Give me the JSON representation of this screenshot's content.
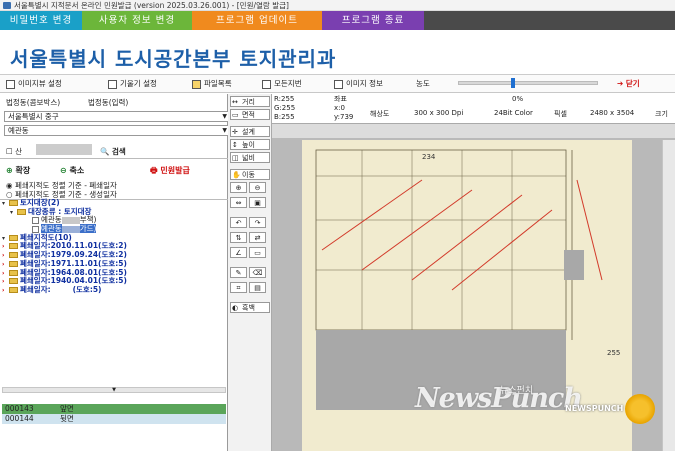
{
  "window": {
    "title": "서울특별시 지적문서 온라인 민원발급 (version 2025.03.26.001) - [민원/열람 발급]"
  },
  "top_menu": [
    {
      "label": "비밀번호 변경",
      "color": "#1aa0c8"
    },
    {
      "label": "사용자 정보 변경",
      "color": "#6cb63a"
    },
    {
      "label": "프로그램 업데이트",
      "color": "#f08a1e"
    },
    {
      "label": "프로그램 종료",
      "color": "#7a3fb0"
    }
  ],
  "banner": {
    "org": "서울특별시 도시공간본부 토지관리과"
  },
  "toolbar": {
    "image_view": "이미지뷰 설정",
    "tilt": "기울기 설정",
    "file_list": "파일목록",
    "all_lots": "모든지번",
    "image_info": "이미지 정보",
    "density": "농도",
    "density_percent": "0%",
    "close": "닫기"
  },
  "left": {
    "tab_sido": "법정동(콤보박스)",
    "tab_input": "법정동(입력)",
    "district": "서울특별시 중구",
    "dong": "예관동",
    "mountain": "산",
    "search": "검색",
    "zoom_in": "확장",
    "zoom_out": "축소",
    "issue": "민원발급",
    "radio1": "폐쇄지적도 정렬 기준 - 폐쇄일자",
    "radio2": "폐쇄지적도 정렬 기준 - 생성일자",
    "tree_root": "토지대장(2)",
    "tree_ledger_type": "대장종류 : 토지대장",
    "tree_item1": "예관동",
    "tree_item1_note": "부책)",
    "tree_item2": "예관동",
    "tree_item2_note": "가드)",
    "closed_root": "폐쇄지적도(10)",
    "closed": [
      "폐쇄일자:2010.11.01(도호:2)",
      "폐쇄일자:1979.09.24(도호:2)",
      "폐쇄일자:1971.11.01(도호:5)",
      "폐쇄일자:1964.08.01(도호:5)",
      "폐쇄일자:1940.04.01(도호:5)",
      "폐쇄일자:",
      "(도호:5)"
    ],
    "pages": [
      {
        "code": "000143",
        "side": "앞면"
      },
      {
        "code": "000144",
        "side": "뒷면"
      }
    ]
  },
  "tools": {
    "distance": "거리",
    "area": "면적",
    "fix": "설계",
    "height": "높이",
    "ratio": "넓비",
    "move": "이동",
    "bw": "흑백"
  },
  "image_info": {
    "rgb_r": "R:255",
    "rgb_g": "G:255",
    "rgb_b": "B:255",
    "coord_label": "좌표",
    "coord_x": "x:0",
    "coord_y": "y:739",
    "resolution_label": "해상도",
    "resolution": "300 x 300 Dpi",
    "color_depth": "24Bit Color",
    "pixel_label": "픽셀",
    "pixels": "2480 x 3504",
    "page_label": "크기"
  },
  "document": {
    "page_no": "234",
    "side_no": "255"
  },
  "watermark": {
    "brand": "NewsPunch",
    "kr": "뉴스펀치",
    "small": "NEWSPUNCH"
  }
}
